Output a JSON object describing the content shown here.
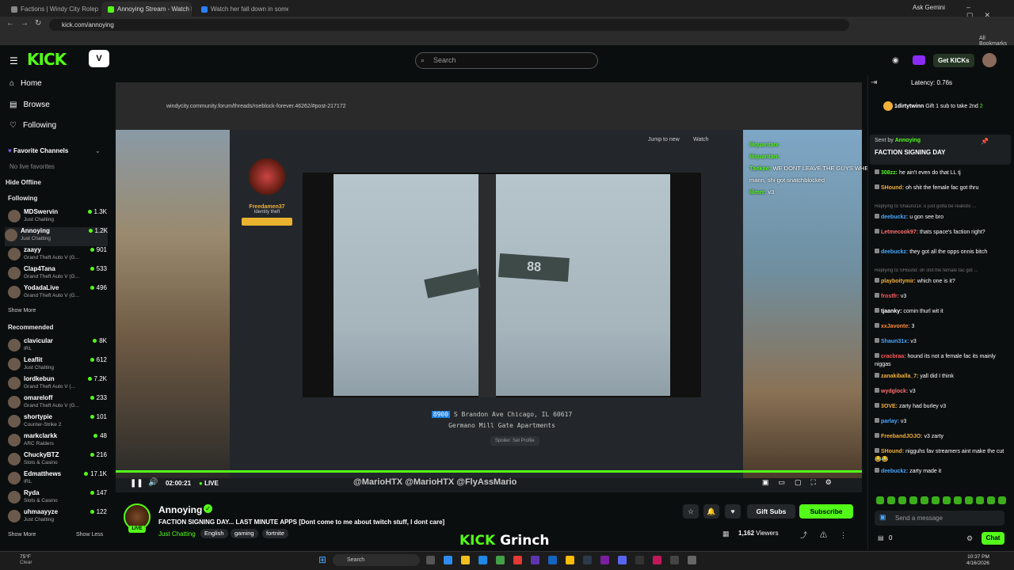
{
  "browser": {
    "tabs": [
      {
        "label": "Factions | Windy City Roleplay"
      },
      {
        "label": "Annoying Stream - Watch Live"
      },
      {
        "label": "Watch her fall down in some…"
      }
    ],
    "url": "kick.com/annoying",
    "ask_gemini": "Ask Gemini",
    "all_bookmarks": "All Bookmarks"
  },
  "header": {
    "logo": "KICK",
    "search_placeholder": "Search",
    "get_kicks": "Get KICKs"
  },
  "sidebar": {
    "nav": [
      {
        "label": "Home",
        "icon": "home-icon"
      },
      {
        "label": "Browse",
        "icon": "browse-icon"
      },
      {
        "label": "Following",
        "icon": "heart-icon"
      }
    ],
    "favorite_channels": "Favorite Channels",
    "no_favorites": "No live favorites",
    "hide_offline": "Hide Offline",
    "following_heading": "Following",
    "following": [
      {
        "name": "MDSwervin",
        "category": "Just Chatting",
        "viewers": "1.3K"
      },
      {
        "name": "Annoying",
        "category": "Just Chatting",
        "viewers": "1.2K"
      },
      {
        "name": "zaayy",
        "category": "Grand Theft Auto V (G...",
        "viewers": "901"
      },
      {
        "name": "Clap4Tana",
        "category": "Grand Theft Auto V (G...",
        "viewers": "533"
      },
      {
        "name": "YodadaLive",
        "category": "Grand Theft Auto V (G...",
        "viewers": "496"
      }
    ],
    "show_more_1": "Show More",
    "recommended_heading": "Recommended",
    "recommended": [
      {
        "name": "clavicular",
        "category": "IRL",
        "viewers": "8K"
      },
      {
        "name": "Leaflit",
        "category": "Just Chatting",
        "viewers": "612"
      },
      {
        "name": "lordkebun",
        "category": "Grand Theft Auto V (...",
        "viewers": "7.2K"
      },
      {
        "name": "omareloff",
        "category": "Grand Theft Auto V (G...",
        "viewers": "233"
      },
      {
        "name": "shortypie",
        "category": "Counter-Strike 2",
        "viewers": "101"
      },
      {
        "name": "markclarkk",
        "category": "ARC Raiders",
        "viewers": "48"
      },
      {
        "name": "ChuckyBTZ",
        "category": "Slots & Casino",
        "viewers": "216"
      },
      {
        "name": "Edmatthews",
        "category": "IRL",
        "viewers": "17.1K"
      },
      {
        "name": "Ryda",
        "category": "Slots & Casino",
        "viewers": "147"
      },
      {
        "name": "uhmaayyze",
        "category": "Just Chatting",
        "viewers": "122"
      }
    ],
    "show_more_2": "Show More",
    "show_less": "Show Less"
  },
  "player": {
    "inner_url": "windycity.community.forum/threads/roeblock-forever.46262/#post-217172",
    "jump_to_new": "Jump to new",
    "watch": "Watch",
    "post_user": "Freedamen37",
    "post_role": "Identity theft",
    "street_sign": "88",
    "address_num": "8900",
    "address_line": "S Brandon Ave Chicago, IL 60617",
    "address_name": "Germano Mill Gate Apartments",
    "spoiler": "Spoiler: Set Profile",
    "overlay_chat": [
      {
        "user": "lilquantan:",
        "text": ""
      },
      {
        "user": "lilquantan:",
        "text": ""
      },
      {
        "user": "Taekae:",
        "text": "WE DONT LEAVE THE GUYS WHEN IT HARD TIMES"
      },
      {
        "user": "",
        "text": "mann, shi got snatchblocked"
      },
      {
        "user": "lilmrr:",
        "text": "v3"
      }
    ],
    "time": "02:00:21",
    "live": "LIVE",
    "watermark": "@MarioHTX   @MarioHTX   @FlyAssMario",
    "progress": 1.0
  },
  "stream": {
    "name": "Annoying",
    "title": "FACTION SIGNING DAY... LAST MINUTE APPS  [Dont come to me about twitch stuff, I dont care]",
    "category": "Just Chatting",
    "tags": [
      "English",
      "gaming",
      "fortnite"
    ],
    "live_badge": "LIVE",
    "gift_subs": "Gift Subs",
    "subscribe": "Subscribe",
    "viewers": "1,162",
    "viewers_label": "Viewers",
    "banner_kick": "KICK",
    "banner_text": "Grinch"
  },
  "chat": {
    "latency": "Latency: 0.76s",
    "gift": {
      "user": "1dirtytwinn",
      "text": "Gift 1 sub to take 2nd",
      "count": "2"
    },
    "pinned": {
      "sent_by": "Sent by",
      "user": "Annoying",
      "title": "FACTION SIGNING DAY"
    },
    "messages": [
      {
        "user": "308zz:",
        "color": "#53fc18",
        "text": "he ain't even do that LL tj"
      },
      {
        "user": "SHound:",
        "color": "#f1b03a",
        "text": "oh shit the female fac got thru"
      },
      {
        "reply": "Replying to Shaun31x: u just gotta be realistic ..."
      },
      {
        "user": "deebuckz:",
        "color": "#4aa8ff",
        "text": "u gon see bro"
      },
      {
        "user": "Letmecook97:",
        "color": "#ff6e6e",
        "text": "thats space's faction right?"
      },
      {
        "user": "deebuckz:",
        "color": "#4aa8ff",
        "text": "they got all the opps onnis bitch"
      },
      {
        "reply": "Replying to SHound: oh shit the female fac got ..."
      },
      {
        "user": "playboitymir:",
        "color": "#f1b03a",
        "text": "which one is it?"
      },
      {
        "user": "frostfr:",
        "color": "#ff5a5a",
        "text": "v3"
      },
      {
        "user": "tjaanky:",
        "color": "#ffffff",
        "text": "comin thurl wit it"
      },
      {
        "user": "xxJavonte:",
        "color": "#ff8a3d",
        "text": "3"
      },
      {
        "user": "Shaun31x:",
        "color": "#4aa8ff",
        "text": "v3"
      },
      {
        "user": "cracbraa:",
        "color": "#ff5a5a",
        "text": "hound its not a female fac its mainly niggas"
      },
      {
        "user": "zanakiballa_7:",
        "color": "#f1b03a",
        "text": "yall did I think"
      },
      {
        "user": "wydglock:",
        "color": "#ff6e6e",
        "text": "v3"
      },
      {
        "user": "3OVE:",
        "color": "#f1b03a",
        "text": "zarty had burley v3"
      },
      {
        "user": "parlay:",
        "color": "#4aa8ff",
        "text": "v3"
      },
      {
        "user": "FreebandJOJO:",
        "color": "#f1b03a",
        "text": "v3 zarty"
      },
      {
        "user": "SHound:",
        "color": "#f1b03a",
        "text": "nigguhs fav streamers aint make the cut 😂😂"
      },
      {
        "user": "deebuckz:",
        "color": "#4aa8ff",
        "text": "zarty made it"
      }
    ],
    "send_placeholder": "Send a message",
    "count": "0",
    "chat_button": "Chat"
  },
  "taskbar": {
    "weather_temp": "75°F",
    "weather_desc": "Clear",
    "search": "Search",
    "time": "10:37 PM",
    "date": "4/16/2026"
  },
  "colors": {
    "accent": "#53fc18",
    "bg": "#0b0e0f"
  }
}
